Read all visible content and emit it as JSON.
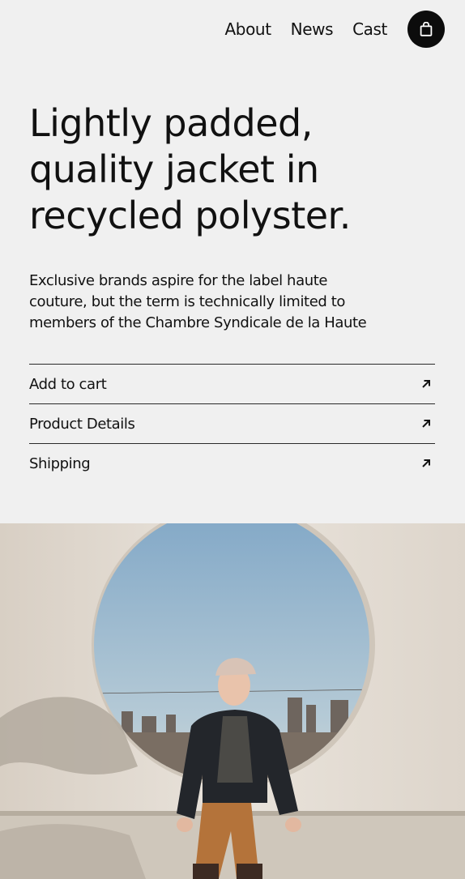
{
  "nav": {
    "items": [
      {
        "label": "About"
      },
      {
        "label": "News"
      },
      {
        "label": "Cast"
      }
    ],
    "cart_icon": "shopping-bag-icon"
  },
  "hero": {
    "title_lines": [
      "Lightly padded,",
      "quality jacket in",
      "recycled polyster."
    ],
    "description_lines": [
      "Exclusive brands aspire for the label haute",
      "couture, but the term is technically limited to",
      "members of the Chambre Syndicale de la Haute"
    ]
  },
  "actions": [
    {
      "label": "Add to cart",
      "icon": "arrow-up-right-icon"
    },
    {
      "label": "Product Details",
      "icon": "arrow-up-right-icon"
    },
    {
      "label": "Shipping",
      "icon": "arrow-up-right-icon"
    }
  ],
  "colors": {
    "background": "#f0f0f0",
    "text": "#111111",
    "cart_button": "#0c0c0c",
    "sky": "#9bbad0",
    "wall": "#e4ddd3"
  }
}
